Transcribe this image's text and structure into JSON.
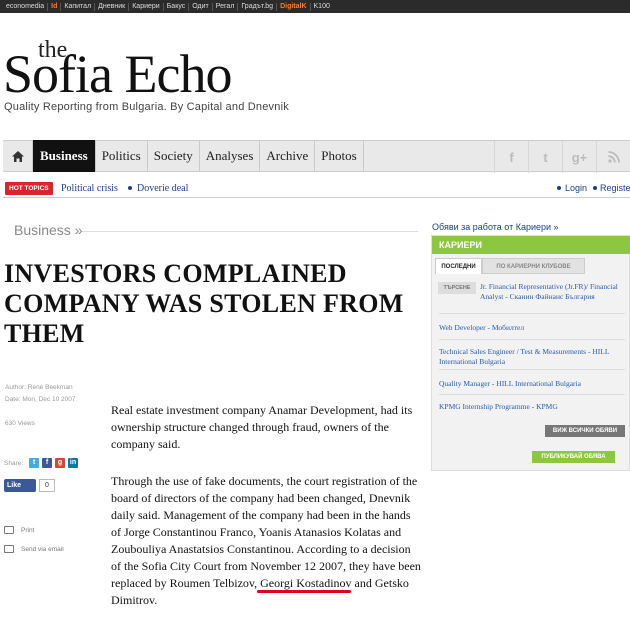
{
  "network_bar": [
    "economedia",
    "Id",
    "Капитал",
    "Дневник",
    "Кариери",
    "Бакус",
    "Одит",
    "Регал",
    "Градът.bg",
    "DigitalK",
    "K100"
  ],
  "logo": {
    "the": "the",
    "main": "Sofia Echo",
    "tagline": "Quality Reporting from Bulgaria. By Capital and Dnevnik"
  },
  "nav": {
    "home_icon": "home-icon",
    "items": [
      "Business",
      "Politics",
      "Society",
      "Analyses",
      "Archive",
      "Photos"
    ],
    "social": [
      "f",
      "t",
      "g+",
      "rss"
    ]
  },
  "hot_topics": {
    "badge": "HOT TOPICS",
    "topics": [
      "Political crisis",
      "Doverie deal"
    ],
    "login": "Login",
    "register": "Register"
  },
  "article": {
    "section": "Business »",
    "title": "INVESTORS COMPLAINED COMPANY WAS STOLEN FROM THEM",
    "author": "Author: Rene Beekman",
    "date": "Date: Mon, Dec 10 2007",
    "views": "630 Views",
    "share_label": "Share:",
    "like_label": "Like",
    "like_count": "0",
    "print_label": "Print",
    "email_label": "Send via email",
    "p1": "Real estate investment company Anamar Development, had its ownership structure changed through fraud, owners of the company said.",
    "p2": "Through the use of fake documents, the court registration of the board of directors of the company had been changed, Dnevnik daily said. Management of the company had been in the hands of Jorge Constantinou Franco, Yoanis Atanasios Kolatas and Zoubouliya Anastatsios Constantinou. According to a decision of the Sofia City Court from November 12 2007, they have been replaced by Roumen Telbizov, Georgi Kostadinov and Getsko Dimitrov."
  },
  "jobs": {
    "top_link": "Обяви за работа от Кариери »",
    "header": "КАРИЕРИ",
    "tab_latest": "ПОСЛЕДНИ",
    "tab_clubs": "ПО КАРИЕРНИ КЛУБОВЕ",
    "search": "ТЪРСЕНЕ",
    "listings": [
      "Jr. Financial Representative (Jr.FR)/ Financial Analyst - Сканин Файнанс България",
      "Web Developer - Мобилтел",
      "Technical Sales Engineer / Test & Measurements - HILL International Bulgaria",
      "Quality Manager - HILL International Bulgaria",
      "KPMG Internship Programme - KPMG"
    ],
    "all_button": "ВИЖ ВСИЧКИ ОБЯВИ",
    "publish_button": "ПУБЛИКУВАЙ ОБЯВА"
  },
  "colors": {
    "accent_green": "#8dc63f",
    "hot_red": "#d9262c",
    "link_blue": "#1a3f8a",
    "highlight_red": "#e0001a"
  }
}
